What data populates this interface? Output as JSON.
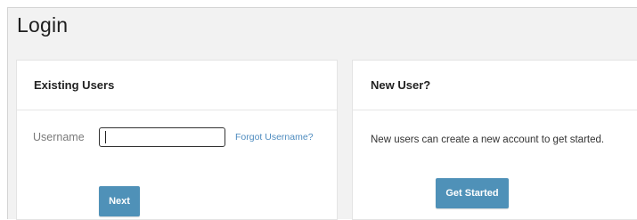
{
  "page": {
    "title": "Login"
  },
  "existing_users": {
    "heading": "Existing Users",
    "username_label": "Username",
    "username_value": "",
    "forgot_username_link": "Forgot Username?",
    "next_button": "Next"
  },
  "new_user": {
    "heading": "New User?",
    "description": "New users can create a new account to get started.",
    "get_started_button": "Get Started"
  },
  "colors": {
    "button_bg": "#4f91b8",
    "link": "#4f8cbf",
    "background": "#f2f2f2"
  }
}
